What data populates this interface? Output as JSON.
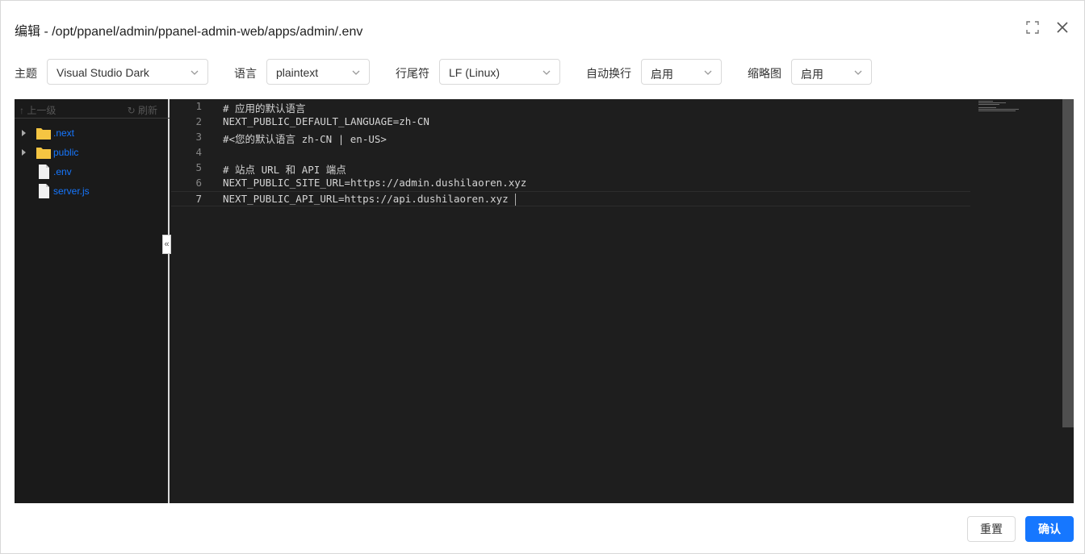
{
  "dialog": {
    "title": "编辑 - /opt/ppanel/admin/ppanel-admin-web/apps/admin/.env",
    "icons": {
      "maximize": "fullscreen-icon",
      "close": "close-icon"
    }
  },
  "toolbar": {
    "theme_label": "主题",
    "theme_value": "Visual Studio Dark",
    "language_label": "语言",
    "language_value": "plaintext",
    "eol_label": "行尾符",
    "eol_value": "LF (Linux)",
    "wrap_label": "自动换行",
    "wrap_value": "启用",
    "minimap_label": "缩略图",
    "minimap_value": "启用"
  },
  "file_tree": {
    "up_label": "上一级",
    "refresh_label": "刷新",
    "items": [
      {
        "name": ".next",
        "type": "folder"
      },
      {
        "name": "public",
        "type": "folder"
      },
      {
        "name": ".env",
        "type": "file"
      },
      {
        "name": "server.js",
        "type": "file"
      }
    ]
  },
  "editor": {
    "active_line": 7,
    "lines": [
      {
        "num": "1",
        "text": "# 应用的默认语言"
      },
      {
        "num": "2",
        "text": "NEXT_PUBLIC_DEFAULT_LANGUAGE=zh-CN"
      },
      {
        "num": "3",
        "text": "#<您的默认语言 zh-CN | en-US>"
      },
      {
        "num": "4",
        "text": ""
      },
      {
        "num": "5",
        "text": "# 站点 URL 和 API 端点"
      },
      {
        "num": "6",
        "text": "NEXT_PUBLIC_SITE_URL=https://admin.dushilaoren.xyz"
      },
      {
        "num": "7",
        "text": "NEXT_PUBLIC_API_URL=https://api.dushilaoren.xyz"
      }
    ]
  },
  "footer": {
    "reset_label": "重置",
    "confirm_label": "确认"
  },
  "colors": {
    "primary": "#1677ff",
    "editor_bg": "#1e1e1e",
    "folder": "#f5c542"
  }
}
